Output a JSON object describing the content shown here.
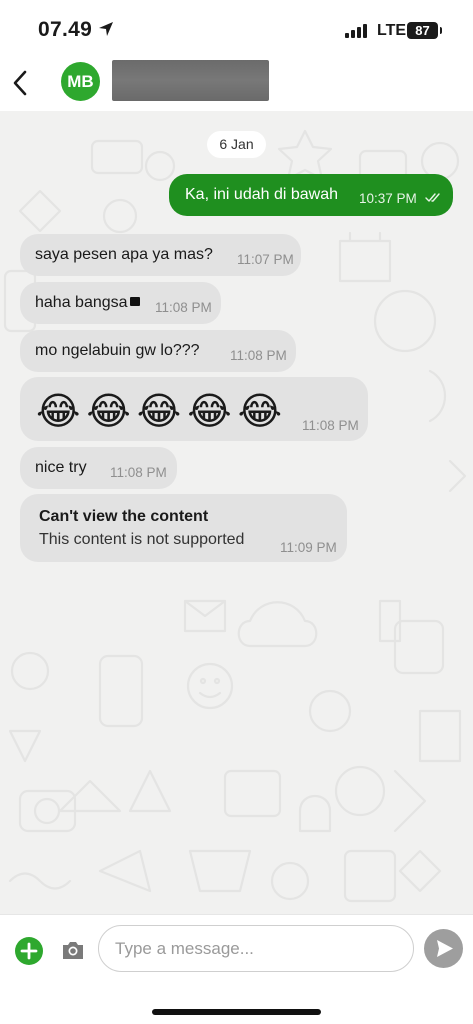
{
  "status_bar": {
    "time": "07.49",
    "network": "LTE",
    "battery": "87"
  },
  "header": {
    "avatar_initials": "MB",
    "back_icon": "chevron-left-icon"
  },
  "chat": {
    "date_chip": "6 Jan",
    "messages": [
      {
        "direction": "out",
        "text": "Ka, ini udah di bawah",
        "time": "10:37 PM",
        "status": "read"
      },
      {
        "direction": "in",
        "text": "saya pesen apa ya mas?",
        "time": "11:07 PM"
      },
      {
        "direction": "in",
        "text": "haha bangsa",
        "time": "11:08 PM"
      },
      {
        "direction": "in",
        "text": "mo ngelabuin gw lo???",
        "time": "11:08 PM"
      },
      {
        "direction": "in",
        "text": "😂😂😂😂😂",
        "time": "11:08 PM"
      },
      {
        "direction": "in",
        "text": "nice try",
        "time": "11:08 PM"
      },
      {
        "direction": "in",
        "title": "Can't view the content",
        "text": "This content is not supported",
        "time": "11:09 PM"
      }
    ]
  },
  "input_bar": {
    "placeholder": "Type a message...",
    "add_icon": "plus-icon",
    "camera_icon": "camera-icon",
    "send_icon": "send-icon"
  },
  "colors": {
    "accent_green": "#2ea82e",
    "outgoing_bubble": "#1f8f1f",
    "incoming_bubble": "#e2e2e2",
    "chat_background": "#f1f1f0"
  }
}
